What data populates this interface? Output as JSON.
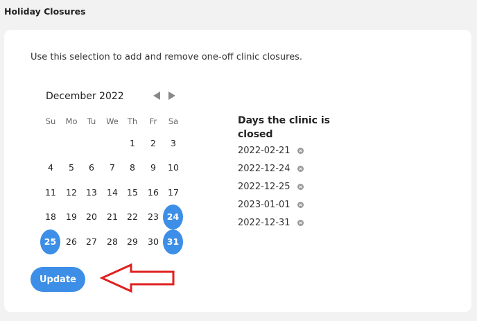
{
  "section": {
    "title": "Holiday Closures"
  },
  "intro": "Use this selection to add and remove one-off clinic closures.",
  "calendar": {
    "month_label": "December 2022",
    "weekdays": [
      "Su",
      "Mo",
      "Tu",
      "We",
      "Th",
      "Fr",
      "Sa"
    ],
    "weeks": [
      [
        "",
        "",
        "",
        "",
        "1",
        "2",
        "3"
      ],
      [
        "4",
        "5",
        "6",
        "7",
        "8",
        "9",
        "10"
      ],
      [
        "11",
        "12",
        "13",
        "14",
        "15",
        "16",
        "17"
      ],
      [
        "18",
        "19",
        "20",
        "21",
        "22",
        "23",
        "24"
      ],
      [
        "25",
        "26",
        "27",
        "28",
        "29",
        "30",
        "31"
      ]
    ],
    "selected_days": [
      "24",
      "25",
      "31"
    ]
  },
  "closed": {
    "title": "Days the clinic is closed",
    "dates": [
      "2022-02-21",
      "2022-12-24",
      "2022-12-25",
      "2023-01-01",
      "2022-12-31"
    ]
  },
  "actions": {
    "update_label": "Update"
  },
  "colors": {
    "accent": "#3d8ee6",
    "annotation": "#e02020",
    "remove_icon": "#999999"
  }
}
